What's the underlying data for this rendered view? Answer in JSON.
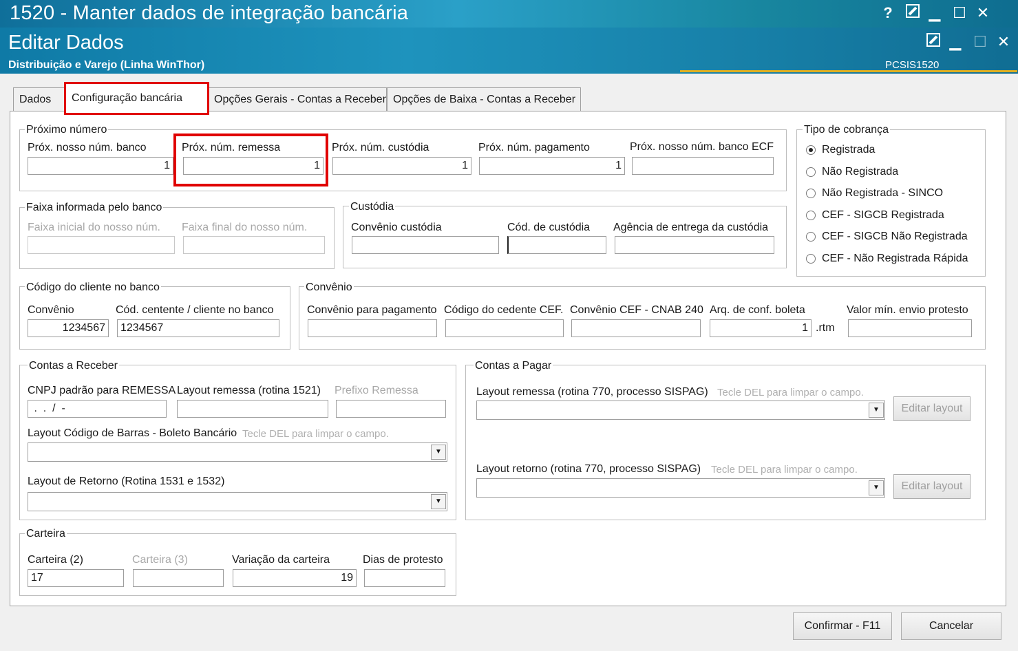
{
  "window": {
    "title": "1520 - Manter dados de integração bancária",
    "title_icons": [
      "help-icon",
      "edit-icon",
      "minimize-icon",
      "maximize-icon",
      "close-icon"
    ],
    "subtitle": "Editar Dados",
    "subsubtitle": "Distribuição e Varejo (Linha WinThor)",
    "code": "PCSIS1520",
    "header_color": "#1a8fbb",
    "accent_gold": "#e2b020",
    "highlight_color": "#e00000"
  },
  "tabs": [
    {
      "label": "Dados"
    },
    {
      "label": "Configuração bancária"
    },
    {
      "label": "Opções Gerais - Contas a Receber"
    },
    {
      "label": "Opções de Baixa - Contas a Receber"
    }
  ],
  "proximo_numero": {
    "title": "Próximo número",
    "fields": [
      {
        "label": "Próx. nosso núm. banco",
        "value": "1"
      },
      {
        "label": "Próx. núm. remessa",
        "value": "1"
      },
      {
        "label": "Próx. núm. custódia",
        "value": "1"
      },
      {
        "label": "Próx. núm. pagamento",
        "value": "1"
      },
      {
        "label": "Próx. nosso núm. banco ECF",
        "value": ""
      }
    ]
  },
  "tipo_cobranca": {
    "title": "Tipo de cobrança",
    "options": [
      {
        "label": "Registrada",
        "selected": true
      },
      {
        "label": "Não Registrada",
        "selected": false
      },
      {
        "label": "Não Registrada - SINCO",
        "selected": false
      },
      {
        "label": "CEF - SIGCB Registrada",
        "selected": false
      },
      {
        "label": "CEF - SIGCB Não Registrada",
        "selected": false
      },
      {
        "label": "CEF - Não Registrada Rápida",
        "selected": false
      }
    ]
  },
  "faixa": {
    "title": "Faixa informada pelo banco",
    "inicial_label": "Faixa inicial do nosso núm.",
    "final_label": "Faixa final do nosso núm."
  },
  "custodia": {
    "title": "Custódia",
    "convenio_label": "Convênio custódia",
    "codigo_label": "Cód. de custódia",
    "agencia_label": "Agência de entrega da custódia"
  },
  "codigo_cliente": {
    "title": "Código do cliente no banco",
    "convenio_label": "Convênio",
    "convenio_value": "1234567",
    "cedente_label": "Cód. centente / cliente no banco",
    "cedente_value": "1234567"
  },
  "convenio": {
    "title": "Convênio",
    "pagamento_label": "Convênio para pagamento",
    "cedente_cef_label": "Código do cedente CEF.",
    "cnab_label": "Convênio CEF - CNAB 240",
    "arq_label": "Arq. de conf. boleta",
    "arq_value": "1",
    "arq_suffix": ".rtm",
    "protesto_label": "Valor mín. envio protesto"
  },
  "contas_receber": {
    "title": "Contas a Receber",
    "cnpj_label": "CNPJ padrão para REMESSA",
    "cnpj_value": " .  .  /  -",
    "layout_remessa_label": "Layout remessa (rotina 1521)",
    "prefixo_label": "Prefixo Remessa",
    "barras_label": "Layout Código de Barras - Boleto Bancário",
    "del_hint": "Tecle DEL para limpar o campo.",
    "retorno_label": "Layout  de Retorno (Rotina 1531 e 1532)"
  },
  "contas_pagar": {
    "title": "Contas a Pagar",
    "remessa_label": "Layout remessa (rotina 770, processo SISPAG)",
    "retorno_label": "Layout retorno (rotina 770, processo SISPAG)",
    "del_hint": "Tecle DEL para limpar o campo.",
    "edit_button": "Editar layout"
  },
  "carteira": {
    "title": "Carteira",
    "carteira2_label": "Carteira (2)",
    "carteira2_value": "17",
    "carteira3_label": "Carteira (3)",
    "variacao_label": "Variação da carteira",
    "variacao_value": "19",
    "dias_label": "Dias de protesto"
  },
  "buttons": {
    "confirm": "Confirmar - F11",
    "cancel": "Cancelar"
  }
}
